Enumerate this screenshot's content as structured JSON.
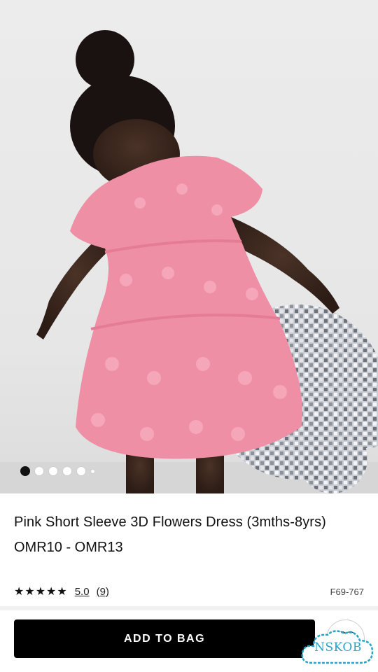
{
  "product": {
    "title": "Pink Short Sleeve 3D Flowers Dress (3mths-8yrs)",
    "price": "OMR10 - OMR13",
    "rating": 5.0,
    "rating_text": "5.0",
    "stars_glyphs": "★★★★★",
    "review_count": "(9)",
    "sku": "F69-767"
  },
  "gallery": {
    "total_images": 6,
    "active_index": 0
  },
  "actions": {
    "add_to_bag_label": "ADD TO BAG"
  },
  "watermark": {
    "text": "NSKOB"
  },
  "colors": {
    "dress_pink": "#ee8fa6",
    "button_black": "#000000",
    "watermark_blue": "#2aa3c9"
  },
  "icons": {
    "favourite": "heart-icon"
  }
}
